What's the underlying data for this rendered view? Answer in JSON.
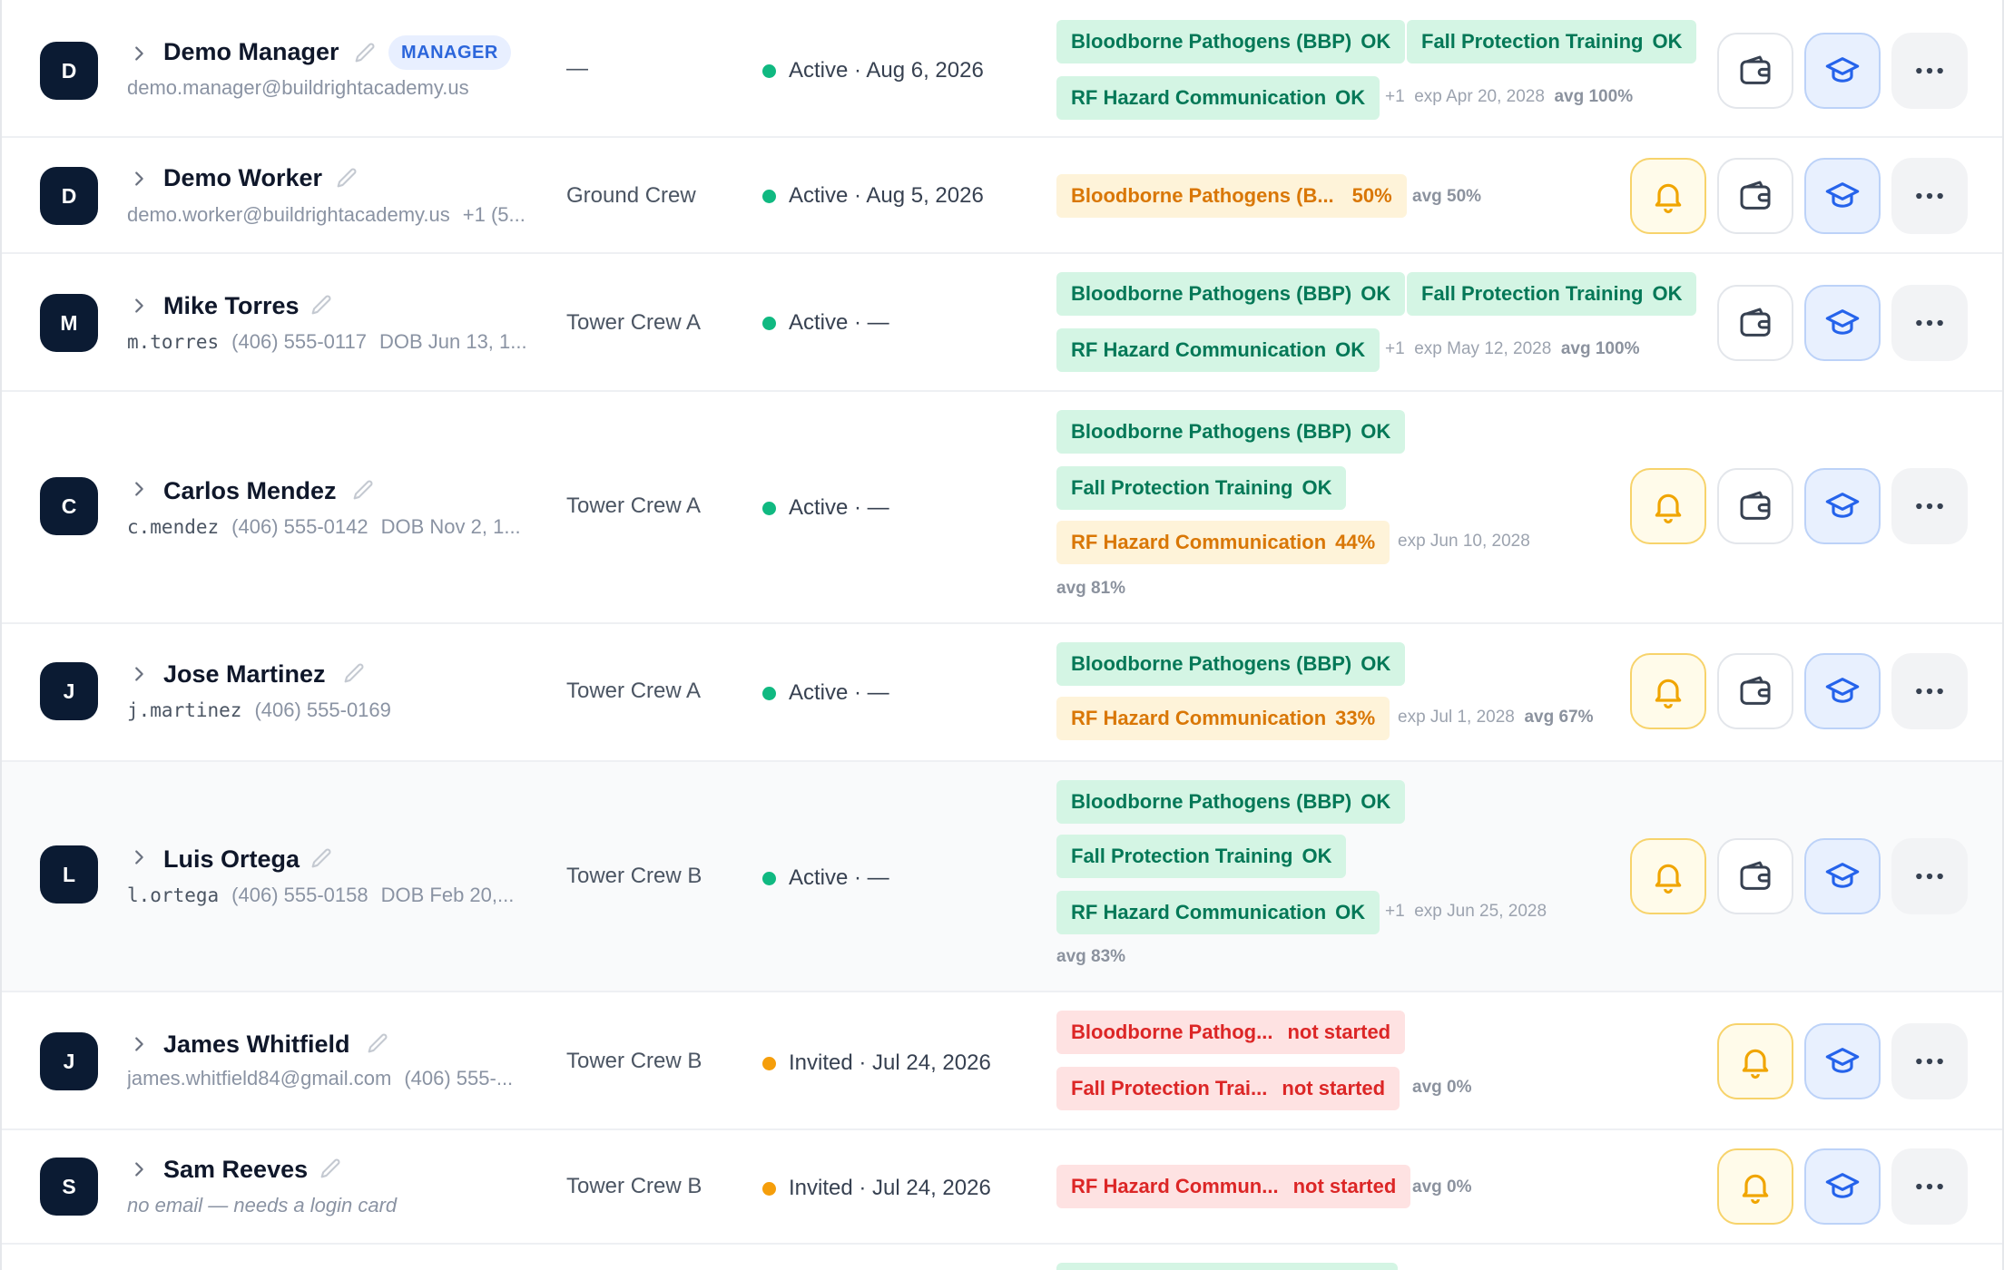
{
  "colors": {
    "avatar_bg": "#0b1b33",
    "ok_bg": "#d4f5e4",
    "ok_text": "#047857",
    "warn_bg": "#fef3d9",
    "warn_text": "#d97706",
    "err_bg": "#fee2e2",
    "err_text": "#dc2626",
    "active_dot": "#10b981",
    "invited_dot": "#f59e0b"
  },
  "icons": {
    "expand": "chevron-right-icon",
    "edit": "pencil-icon",
    "remind": "bell-icon",
    "wallet": "wallet-icon",
    "training": "graduation-cap-icon",
    "more": "more-horizontal-icon"
  },
  "rows": [
    {
      "initial": "D",
      "name": "Demo Manager",
      "role_badge": "MANAGER",
      "sub": [
        "demo.manager@buildrightacademy.us"
      ],
      "crew": "—",
      "status": "Active · Aug 6, 2026",
      "certs": [
        {
          "label": "Bloodborne Pathogens (BBP)",
          "status": "OK",
          "tone": "ok"
        },
        {
          "label": "Fall Protection Training",
          "status": "OK",
          "tone": "ok"
        },
        {
          "label": "RF Hazard Communication",
          "status": "OK",
          "tone": "ok"
        }
      ],
      "extra": "+1",
      "exp": "exp Apr 20, 2028",
      "avg": "avg 100%"
    },
    {
      "initial": "D",
      "name": "Demo Worker",
      "sub": [
        "demo.worker@buildrightacademy.us",
        "+1 (5..."
      ],
      "crew": "Ground Crew",
      "status": "Active · Aug 5, 2026",
      "certs": [
        {
          "label": "Bloodborne Pathogens (B...",
          "status": "50%",
          "tone": "warn"
        }
      ],
      "avg": "avg 50%"
    },
    {
      "initial": "M",
      "name": "Mike Torres",
      "sub": [
        "m.torres",
        "(406) 555-0117",
        "DOB Jun 13, 1..."
      ],
      "crew": "Tower Crew A",
      "status": "Active · —",
      "certs": [
        {
          "label": "Bloodborne Pathogens (BBP)",
          "status": "OK",
          "tone": "ok"
        },
        {
          "label": "Fall Protection Training",
          "status": "OK",
          "tone": "ok"
        },
        {
          "label": "RF Hazard Communication",
          "status": "OK",
          "tone": "ok"
        }
      ],
      "extra": "+1",
      "exp": "exp May 12, 2028",
      "avg": "avg 100%"
    },
    {
      "initial": "C",
      "name": "Carlos Mendez",
      "sub": [
        "c.mendez",
        "(406) 555-0142",
        "DOB Nov 2, 1..."
      ],
      "crew": "Tower Crew A",
      "status": "Active · —",
      "certs": [
        {
          "label": "Bloodborne Pathogens (BBP)",
          "status": "OK",
          "tone": "ok"
        },
        {
          "label": "Fall Protection Training",
          "status": "OK",
          "tone": "ok"
        },
        {
          "label": "RF Hazard Communication",
          "status": "44%",
          "tone": "warn"
        }
      ],
      "exp": "exp Jun 10, 2028",
      "avg": "avg 81%"
    },
    {
      "initial": "J",
      "name": "Jose Martinez",
      "sub": [
        "j.martinez",
        "(406) 555-0169"
      ],
      "crew": "Tower Crew A",
      "status": "Active · —",
      "certs": [
        {
          "label": "Bloodborne Pathogens (BBP)",
          "status": "OK",
          "tone": "ok"
        },
        {
          "label": "RF Hazard Communication",
          "status": "33%",
          "tone": "warn"
        }
      ],
      "exp": "exp Jul 1, 2028",
      "avg": "avg 67%"
    },
    {
      "initial": "L",
      "name": "Luis Ortega",
      "sub": [
        "l.ortega",
        "(406) 555-0158",
        "DOB Feb 20,..."
      ],
      "crew": "Tower Crew B",
      "status": "Active · —",
      "certs": [
        {
          "label": "Bloodborne Pathogens (BBP)",
          "status": "OK",
          "tone": "ok"
        },
        {
          "label": "Fall Protection Training",
          "status": "OK",
          "tone": "ok"
        },
        {
          "label": "RF Hazard Communication",
          "status": "OK",
          "tone": "ok"
        }
      ],
      "extra": "+1",
      "exp": "exp Jun 25, 2028",
      "avg": "avg 83%"
    },
    {
      "initial": "J",
      "name": "James Whitfield",
      "sub": [
        "james.whitfield84@gmail.com",
        "(406) 555-..."
      ],
      "crew": "Tower Crew B",
      "status": "Invited · Jul 24, 2026",
      "certs": [
        {
          "label": "Bloodborne Pathog...",
          "status": "not started",
          "tone": "err"
        },
        {
          "label": "Fall Protection Trai...",
          "status": "not started",
          "tone": "err"
        }
      ],
      "avg": "avg 0%"
    },
    {
      "initial": "S",
      "name": "Sam Reeves",
      "sub": [
        "no email — needs a login card"
      ],
      "crew": "Tower Crew B",
      "status": "Invited · Jul 24, 2026",
      "certs": [
        {
          "label": "RF Hazard Commun...",
          "status": "not started",
          "tone": "err"
        }
      ],
      "avg": "avg 0%"
    }
  ]
}
